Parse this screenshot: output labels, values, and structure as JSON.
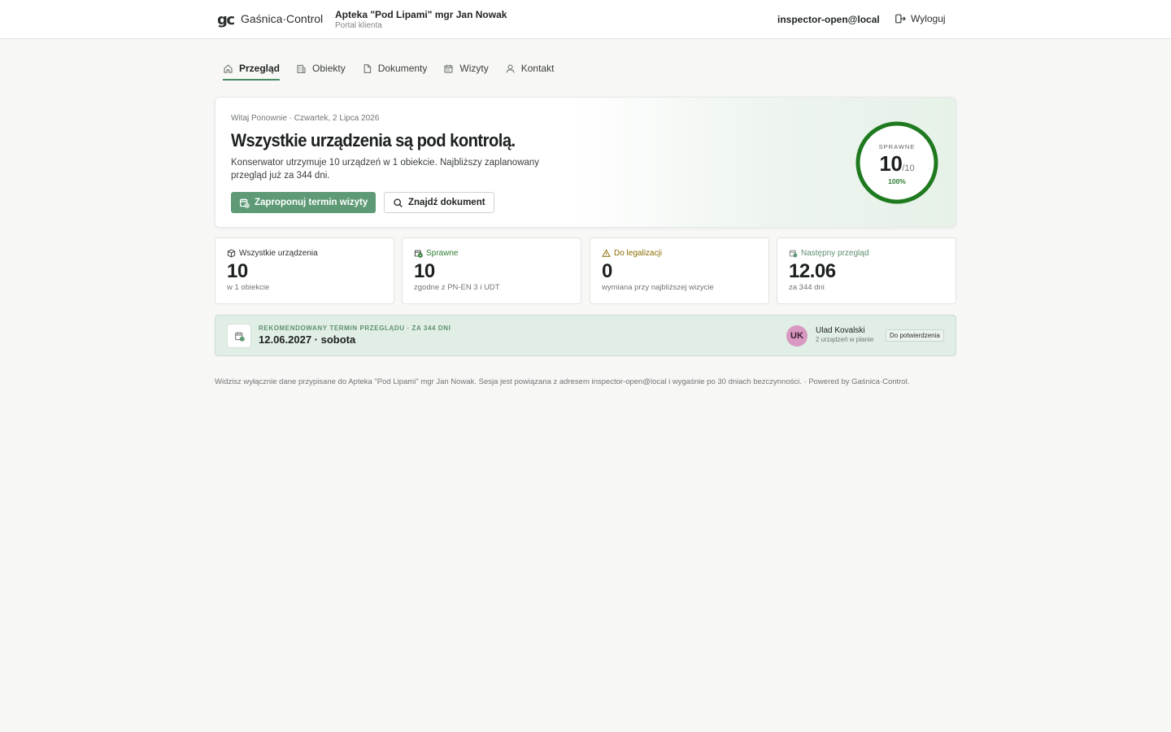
{
  "header": {
    "logo": "gc",
    "brand": "Gaśnica·Control",
    "client_name": "Apteka \"Pod Lipami\" mgr Jan Nowak",
    "client_sub": "Portal klienta",
    "user_email": "inspector-open@local",
    "logout_label": "Wyloguj"
  },
  "tabs": [
    {
      "label": "Przegląd",
      "icon": "home-icon",
      "active": true
    },
    {
      "label": "Obiekty",
      "icon": "building-icon",
      "active": false
    },
    {
      "label": "Dokumenty",
      "icon": "document-icon",
      "active": false
    },
    {
      "label": "Wizyty",
      "icon": "calendar-icon",
      "active": false
    },
    {
      "label": "Kontakt",
      "icon": "user-icon",
      "active": false
    }
  ],
  "hero": {
    "greeting": "Witaj Ponownie · Czwartek, 2 Lipca 2026",
    "headline": "Wszystkie urządzenia są pod kontrolą.",
    "description": "Konserwator utrzymuje 10 urządzeń w 1 obiekcie. Najbliższy zaplanowany przegląd już za 344 dni.",
    "primary_button": "Zaproponuj termin wizyty",
    "secondary_button": "Znajdź dokument",
    "gauge": {
      "label": "SPRAWNE",
      "value": "10",
      "total": "/10",
      "percent": "100%",
      "fraction": 1.0,
      "color": "#1f7a1f"
    }
  },
  "stats": [
    {
      "label": "Wszystkie urządzenia",
      "value": "10",
      "note": "w 1 obiekcie",
      "icon": "box-icon",
      "color": "#2b2f2c"
    },
    {
      "label": "Sprawne",
      "value": "10",
      "note": "zgodne z PN-EN 3 i UDT",
      "icon": "check-calendar-icon",
      "color": "#2e7d32"
    },
    {
      "label": "Do legalizacji",
      "value": "0",
      "note": "wymiana przy najbliższej wizycie",
      "icon": "warning-icon",
      "color": "#8a6d00"
    },
    {
      "label": "Następny przegląd",
      "value": "12.06",
      "note": "za 344 dni",
      "icon": "calendar-icon",
      "color": "#5e8f6f"
    }
  ],
  "recommendation": {
    "label": "REKOMENDOWANY TERMIN PRZEGLĄDU · ZA 344 DNI",
    "date": "12.06.2027 · sobota",
    "avatar_initials": "UK",
    "person_name": "Ulad Kovalski",
    "person_sub": "2 urządzeń w planie",
    "status": "Do potwierdzenia"
  },
  "footer": "Widzisz wyłącznie dane przypisane do Apteka \"Pod Lipami\" mgr Jan Nowak. Sesja jest powiązana z adresem inspector-open@local i wygaśnie po 30 dniach bezczynności. · Powered by Gaśnica·Control."
}
